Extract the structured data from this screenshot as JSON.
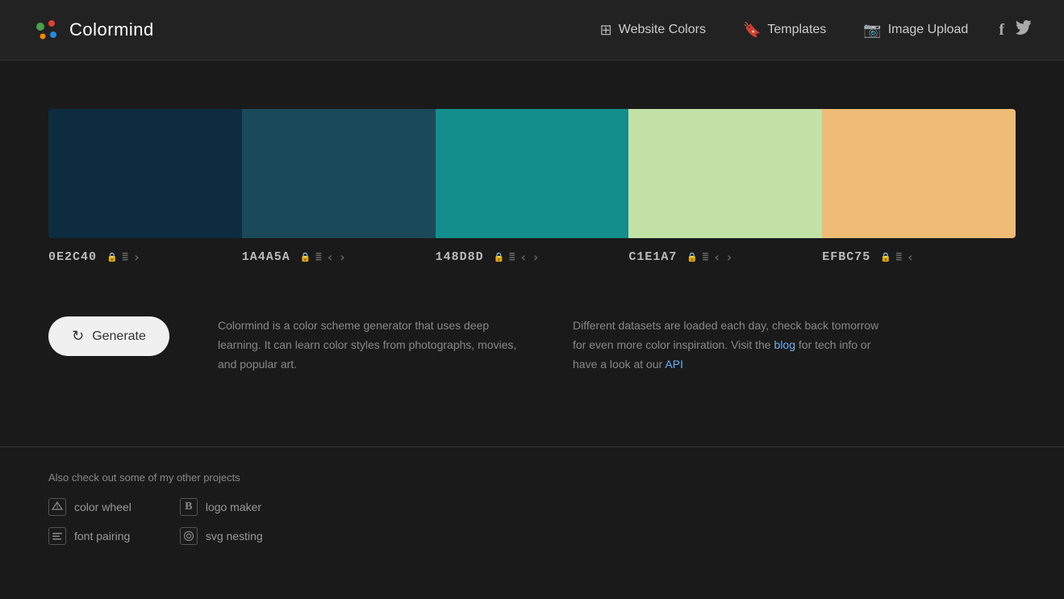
{
  "nav": {
    "logo_text": "Colormind",
    "links": [
      {
        "label": "Website Colors",
        "icon": "⊞",
        "href": "#"
      },
      {
        "label": "Templates",
        "icon": "🔖",
        "href": "#"
      },
      {
        "label": "Image Upload",
        "icon": "📷",
        "href": "#"
      }
    ],
    "social": [
      {
        "label": "Facebook",
        "icon": "f",
        "href": "#"
      },
      {
        "label": "Twitter",
        "icon": "🐦",
        "href": "#"
      }
    ]
  },
  "palette": {
    "swatches": [
      {
        "color": "#0E2C40",
        "hex": "0E2C40"
      },
      {
        "color": "#1A4A5A",
        "hex": "1A4A5A"
      },
      {
        "color": "#148D8D",
        "hex": "148D8D"
      },
      {
        "color": "#C1E1A7",
        "hex": "C1E1A7"
      },
      {
        "color": "#EFBC75",
        "hex": "EFBC75"
      }
    ]
  },
  "generate": {
    "button_label": "Generate",
    "refresh_icon": "↻"
  },
  "info": {
    "left_text": "Colormind is a color scheme generator that uses deep learning. It can learn color styles from photographs, movies, and popular art.",
    "right_text_1": "Different datasets are loaded each day, check back tomorrow for even more color inspiration. Visit the ",
    "right_blog_label": "blog",
    "right_blog_href": "#",
    "right_text_2": " for tech info or have a look at our ",
    "right_api_label": "API",
    "right_api_href": "#"
  },
  "footer": {
    "also_label": "Also check out some of my other projects",
    "links": [
      {
        "label": "color wheel",
        "icon": "◈",
        "href": "#"
      },
      {
        "label": "logo maker",
        "icon": "B",
        "href": "#"
      },
      {
        "label": "font pairing",
        "icon": "≡",
        "href": "#"
      },
      {
        "label": "svg nesting",
        "icon": "◎",
        "href": "#"
      }
    ]
  }
}
